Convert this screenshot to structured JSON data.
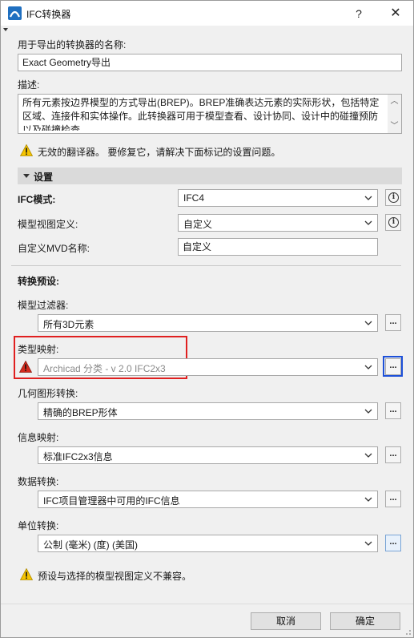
{
  "window": {
    "title": "IFC转换器",
    "help_symbol": "?",
    "close_symbol": "✕"
  },
  "name_section": {
    "label": "用于导出的转换器的名称:",
    "value": "Exact Geometry导出"
  },
  "description_section": {
    "label": "描述:",
    "value": "所有元素按边界模型的方式导出(BREP)。BREP准确表达元素的实际形状，包括特定区域、连接件和实体操作。此转换器可用于模型查看、设计协同、设计中的碰撞预防以及碰撞检查"
  },
  "top_warning": {
    "text": "无效的翻译器。 要修复它，请解决下面标记的设置问题。"
  },
  "settings": {
    "header": "设置",
    "ifc_mode": {
      "label": "IFC模式:",
      "value": "IFC4"
    },
    "model_view": {
      "label": "模型视图定义:",
      "value": "自定义"
    },
    "custom_mvd": {
      "label": "自定义MVD名称:",
      "value": "自定义"
    }
  },
  "presets": {
    "title": "转换预设:",
    "dots": "...",
    "model_filter": {
      "label": "模型过滤器:",
      "value": "所有3D元素"
    },
    "type_mapping": {
      "label": "类型映射:",
      "value": "Archicad 分类 - v 2.0 IFC2x3"
    },
    "geometry": {
      "label": "几何图形转换:",
      "value": "精确的BREP形体"
    },
    "property_mapping": {
      "label": "信息映射:",
      "value": "标准IFC2x3信息"
    },
    "data_conversion": {
      "label": "数据转换:",
      "value": "IFC项目管理器中可用的IFC信息"
    },
    "unit_conversion": {
      "label": "单位转换:",
      "value": "公制 (毫米) (度) (美国)"
    }
  },
  "bottom_warning": {
    "text": "预设与选择的模型视图定义不兼容。"
  },
  "footer": {
    "cancel": "取消",
    "ok": "确定"
  },
  "colors": {
    "warning_yellow": "#f5c400",
    "error_red": "#d42b1e",
    "highlight_red": "#e02020",
    "highlight_blue": "#1d50d8"
  }
}
